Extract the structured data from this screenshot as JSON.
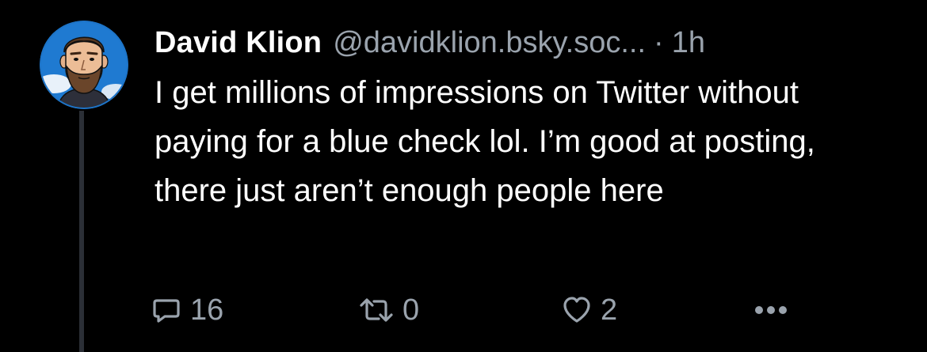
{
  "post": {
    "author_name": "David Klion",
    "handle": "@davidklion.bsky.soc...",
    "separator": "·",
    "time": "1h",
    "text": "I get millions of impressions on Twitter without paying for a blue check lol. I’m good at posting, there just aren’t enough people here"
  },
  "actions": {
    "reply_icon": "speech-bubble-icon",
    "reply_count": "16",
    "repost_icon": "repost-arrows-icon",
    "repost_count": "0",
    "like_icon": "heart-icon",
    "like_count": "2",
    "more_icon": "ellipsis-icon"
  },
  "colors": {
    "background": "#000000",
    "text_primary": "#ffffff",
    "text_secondary": "#9aa3ad",
    "thread_line": "#2b2f36",
    "avatar_ring": "#1d74c8"
  }
}
